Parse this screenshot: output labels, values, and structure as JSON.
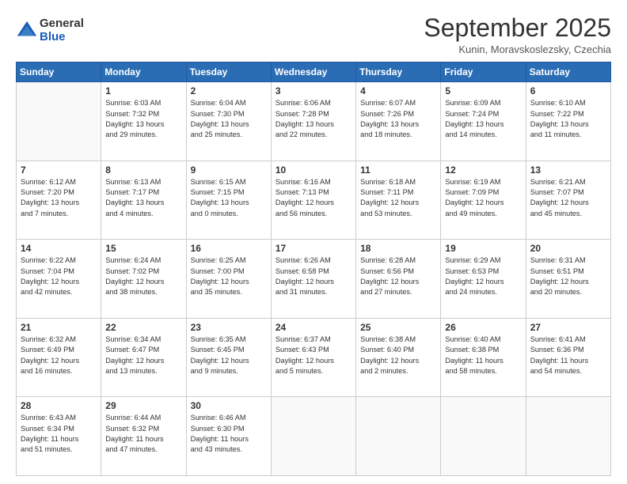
{
  "logo": {
    "general": "General",
    "blue": "Blue"
  },
  "title": "September 2025",
  "subtitle": "Kunin, Moravskoslezsky, Czechia",
  "weekdays": [
    "Sunday",
    "Monday",
    "Tuesday",
    "Wednesday",
    "Thursday",
    "Friday",
    "Saturday"
  ],
  "weeks": [
    [
      {
        "day": "",
        "info": ""
      },
      {
        "day": "1",
        "info": "Sunrise: 6:03 AM\nSunset: 7:32 PM\nDaylight: 13 hours\nand 29 minutes."
      },
      {
        "day": "2",
        "info": "Sunrise: 6:04 AM\nSunset: 7:30 PM\nDaylight: 13 hours\nand 25 minutes."
      },
      {
        "day": "3",
        "info": "Sunrise: 6:06 AM\nSunset: 7:28 PM\nDaylight: 13 hours\nand 22 minutes."
      },
      {
        "day": "4",
        "info": "Sunrise: 6:07 AM\nSunset: 7:26 PM\nDaylight: 13 hours\nand 18 minutes."
      },
      {
        "day": "5",
        "info": "Sunrise: 6:09 AM\nSunset: 7:24 PM\nDaylight: 13 hours\nand 14 minutes."
      },
      {
        "day": "6",
        "info": "Sunrise: 6:10 AM\nSunset: 7:22 PM\nDaylight: 13 hours\nand 11 minutes."
      }
    ],
    [
      {
        "day": "7",
        "info": "Sunrise: 6:12 AM\nSunset: 7:20 PM\nDaylight: 13 hours\nand 7 minutes."
      },
      {
        "day": "8",
        "info": "Sunrise: 6:13 AM\nSunset: 7:17 PM\nDaylight: 13 hours\nand 4 minutes."
      },
      {
        "day": "9",
        "info": "Sunrise: 6:15 AM\nSunset: 7:15 PM\nDaylight: 13 hours\nand 0 minutes."
      },
      {
        "day": "10",
        "info": "Sunrise: 6:16 AM\nSunset: 7:13 PM\nDaylight: 12 hours\nand 56 minutes."
      },
      {
        "day": "11",
        "info": "Sunrise: 6:18 AM\nSunset: 7:11 PM\nDaylight: 12 hours\nand 53 minutes."
      },
      {
        "day": "12",
        "info": "Sunrise: 6:19 AM\nSunset: 7:09 PM\nDaylight: 12 hours\nand 49 minutes."
      },
      {
        "day": "13",
        "info": "Sunrise: 6:21 AM\nSunset: 7:07 PM\nDaylight: 12 hours\nand 45 minutes."
      }
    ],
    [
      {
        "day": "14",
        "info": "Sunrise: 6:22 AM\nSunset: 7:04 PM\nDaylight: 12 hours\nand 42 minutes."
      },
      {
        "day": "15",
        "info": "Sunrise: 6:24 AM\nSunset: 7:02 PM\nDaylight: 12 hours\nand 38 minutes."
      },
      {
        "day": "16",
        "info": "Sunrise: 6:25 AM\nSunset: 7:00 PM\nDaylight: 12 hours\nand 35 minutes."
      },
      {
        "day": "17",
        "info": "Sunrise: 6:26 AM\nSunset: 6:58 PM\nDaylight: 12 hours\nand 31 minutes."
      },
      {
        "day": "18",
        "info": "Sunrise: 6:28 AM\nSunset: 6:56 PM\nDaylight: 12 hours\nand 27 minutes."
      },
      {
        "day": "19",
        "info": "Sunrise: 6:29 AM\nSunset: 6:53 PM\nDaylight: 12 hours\nand 24 minutes."
      },
      {
        "day": "20",
        "info": "Sunrise: 6:31 AM\nSunset: 6:51 PM\nDaylight: 12 hours\nand 20 minutes."
      }
    ],
    [
      {
        "day": "21",
        "info": "Sunrise: 6:32 AM\nSunset: 6:49 PM\nDaylight: 12 hours\nand 16 minutes."
      },
      {
        "day": "22",
        "info": "Sunrise: 6:34 AM\nSunset: 6:47 PM\nDaylight: 12 hours\nand 13 minutes."
      },
      {
        "day": "23",
        "info": "Sunrise: 6:35 AM\nSunset: 6:45 PM\nDaylight: 12 hours\nand 9 minutes."
      },
      {
        "day": "24",
        "info": "Sunrise: 6:37 AM\nSunset: 6:43 PM\nDaylight: 12 hours\nand 5 minutes."
      },
      {
        "day": "25",
        "info": "Sunrise: 6:38 AM\nSunset: 6:40 PM\nDaylight: 12 hours\nand 2 minutes."
      },
      {
        "day": "26",
        "info": "Sunrise: 6:40 AM\nSunset: 6:38 PM\nDaylight: 11 hours\nand 58 minutes."
      },
      {
        "day": "27",
        "info": "Sunrise: 6:41 AM\nSunset: 6:36 PM\nDaylight: 11 hours\nand 54 minutes."
      }
    ],
    [
      {
        "day": "28",
        "info": "Sunrise: 6:43 AM\nSunset: 6:34 PM\nDaylight: 11 hours\nand 51 minutes."
      },
      {
        "day": "29",
        "info": "Sunrise: 6:44 AM\nSunset: 6:32 PM\nDaylight: 11 hours\nand 47 minutes."
      },
      {
        "day": "30",
        "info": "Sunrise: 6:46 AM\nSunset: 6:30 PM\nDaylight: 11 hours\nand 43 minutes."
      },
      {
        "day": "",
        "info": ""
      },
      {
        "day": "",
        "info": ""
      },
      {
        "day": "",
        "info": ""
      },
      {
        "day": "",
        "info": ""
      }
    ]
  ]
}
